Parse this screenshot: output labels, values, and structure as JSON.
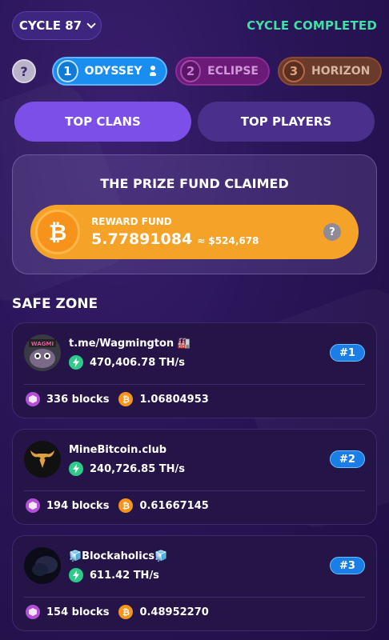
{
  "header": {
    "cycle_label": "CYCLE 87",
    "status": "CYCLE COMPLETED"
  },
  "leagues": [
    {
      "number": "1",
      "name": "ODYSSEY"
    },
    {
      "number": "2",
      "name": "ECLIPSE"
    },
    {
      "number": "3",
      "name": "HORIZON"
    }
  ],
  "tabs": {
    "clans": "TOP CLANS",
    "players": "TOP PLAYERS"
  },
  "prize": {
    "title": "THE PRIZE FUND CLAIMED",
    "reward_label": "REWARD FUND",
    "amount": "5.77891084",
    "usd": "≈ $524,678"
  },
  "safe_zone_title": "SAFE ZONE",
  "clans": [
    {
      "name": "t.me/Wagmington 🏭",
      "hashrate": "470,406.78 TH/s",
      "rank": "#1",
      "blocks": "336 blocks",
      "btc": "1.06804953",
      "avatar_text": "WAGMI"
    },
    {
      "name": "MineBitcoin.club",
      "hashrate": "240,726.85 TH/s",
      "rank": "#2",
      "blocks": "194 blocks",
      "btc": "0.61667145"
    },
    {
      "name": "🧊Blockaholics🧊",
      "hashrate": "611.42 TH/s",
      "rank": "#3",
      "blocks": "154 blocks",
      "btc": "0.48952270"
    }
  ],
  "colors": {
    "accent": "#7c4fe8",
    "status_green": "#3ee0a4",
    "btc_orange": "#f7931a",
    "rank_blue": "#1a7ee6"
  }
}
